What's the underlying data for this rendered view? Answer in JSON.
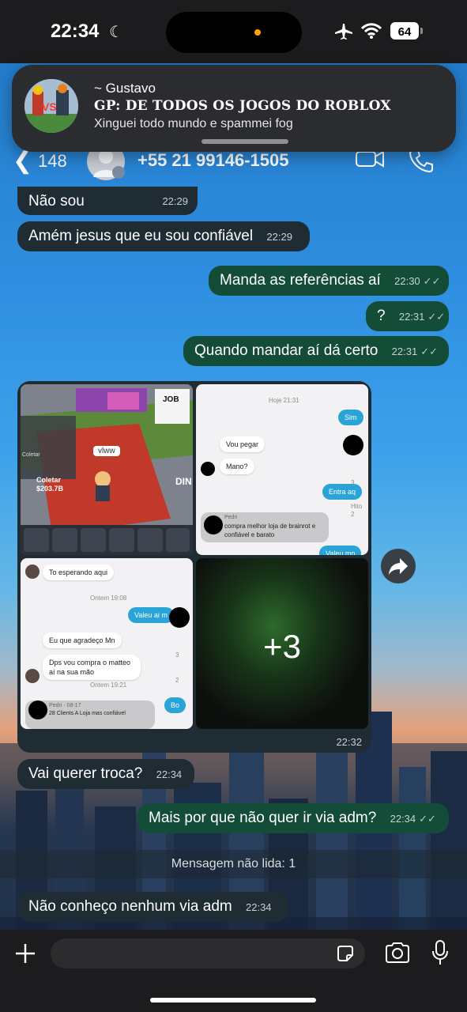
{
  "status_bar": {
    "time": "22:34",
    "battery": "64"
  },
  "notification": {
    "sender": "~ Gustavo",
    "group": "GP: DE TODOS OS JOGOS DO ROBLOX",
    "message": "Xinguei todo mundo e spammei fog"
  },
  "header": {
    "back_count": "148",
    "contact": "+55 21 99146-1505"
  },
  "messages": [
    {
      "text": "Não sou",
      "time": "22:29"
    },
    {
      "text": "Amém jesus que eu sou confiável",
      "time": "22:29"
    },
    {
      "text": "Manda as referências aí",
      "time": "22:30"
    },
    {
      "text": "?",
      "time": "22:31"
    },
    {
      "text": "Quando mandar aí dá certo",
      "time": "22:31"
    },
    {
      "text": "Vai querer troca?",
      "time": "22:34"
    },
    {
      "text": "Mais por que não quer ir via adm?",
      "time": "22:34"
    },
    {
      "text": "Não conheço nenhum via adm",
      "time": "22:34"
    }
  ],
  "media": {
    "time": "22:32",
    "more_count": "+3",
    "game": {
      "label1": "Coletar",
      "value1": "$203.7B",
      "name_tag": "vlww",
      "sign": "JOB",
      "side": "DIN",
      "left_tag": "Coletar"
    },
    "chat1": {
      "date": "Hoje 21:31",
      "msgs": [
        "Sim",
        "Vou pegar",
        "Mano?",
        "Entra aq",
        "Valeu mn"
      ],
      "quote_name": "Pedri",
      "quote_text": "compra melhor loja de brainrot e confiável e barato",
      "info": "Hito",
      "count": "3",
      "count2": "2"
    },
    "chat2": {
      "msgs": [
        "To esperando aqui",
        "Valeu ai m",
        "Eu que agradeço Mn",
        "Dps vou compra o matteo aí na sua mão",
        "Bo"
      ],
      "date1": "Ontem 19:08",
      "date2": "Ontem 19:21",
      "quote": "Pedri · 08-17",
      "quote_text": "28 Clients A Loja mas confiável",
      "count": "3",
      "count2": "2"
    }
  },
  "unread_label": "Mensagem não lida: 1",
  "icons": [
    "moon-icon",
    "airplane-icon",
    "wifi-icon",
    "back-chevron-icon",
    "video-call-icon",
    "phone-icon",
    "forward-icon",
    "plus-icon",
    "sticker-icon",
    "camera-icon",
    "microphone-icon"
  ]
}
